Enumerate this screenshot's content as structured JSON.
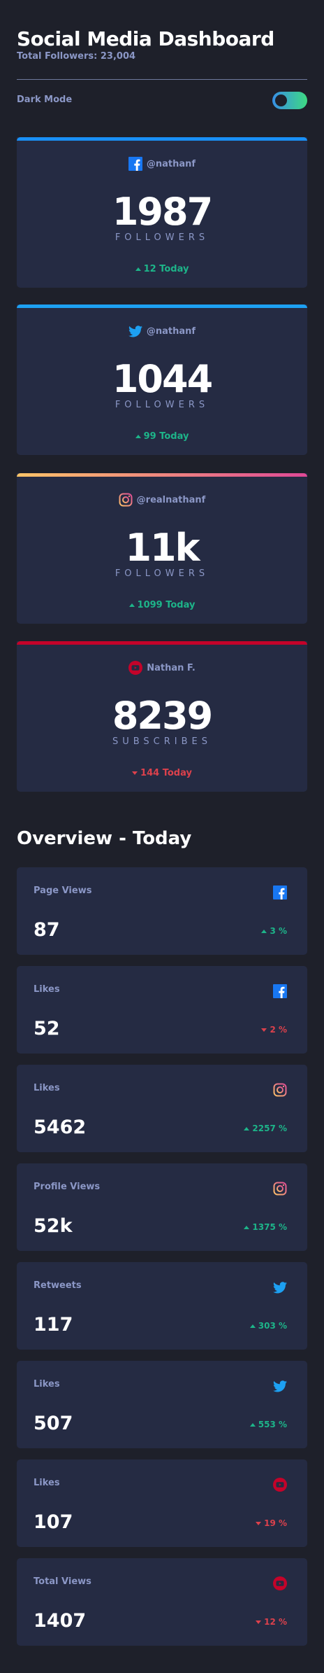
{
  "header": {
    "title": "Social Media Dashboard",
    "total_followers": "Total Followers: 23,004",
    "dark_mode_label": "Dark Mode",
    "dark_mode_on": true
  },
  "colors": {
    "facebook": "#1877f2",
    "twitter": "#1da0f2",
    "instagram_start": "#fdc468",
    "instagram_end": "#df4996",
    "youtube": "#c4032a",
    "up": "#1db489",
    "down": "#dc414c"
  },
  "cards": [
    {
      "platform": "facebook",
      "icon": "facebook-icon",
      "handle": "@nathanf",
      "count": "1987",
      "unit": "FOLLOWERS",
      "change": "12 Today",
      "direction": "up"
    },
    {
      "platform": "twitter",
      "icon": "twitter-icon",
      "handle": "@nathanf",
      "count": "1044",
      "unit": "FOLLOWERS",
      "change": "99 Today",
      "direction": "up"
    },
    {
      "platform": "instagram",
      "icon": "instagram-icon",
      "handle": "@realnathanf",
      "count": "11k",
      "unit": "FOLLOWERS",
      "change": "1099 Today",
      "direction": "up"
    },
    {
      "platform": "youtube",
      "icon": "youtube-icon",
      "handle": "Nathan F.",
      "count": "8239",
      "unit": "SUBSCRIBES",
      "change": "144 Today",
      "direction": "down"
    }
  ],
  "overview": {
    "title": "Overview - Today",
    "items": [
      {
        "metric": "Page Views",
        "platform": "facebook",
        "icon": "facebook-icon",
        "value": "87",
        "change": "3 %",
        "direction": "up"
      },
      {
        "metric": "Likes",
        "platform": "facebook",
        "icon": "facebook-icon",
        "value": "52",
        "change": "2 %",
        "direction": "down"
      },
      {
        "metric": "Likes",
        "platform": "instagram",
        "icon": "instagram-icon",
        "value": "5462",
        "change": "2257 %",
        "direction": "up"
      },
      {
        "metric": "Profile Views",
        "platform": "instagram",
        "icon": "instagram-icon",
        "value": "52k",
        "change": "1375 %",
        "direction": "up"
      },
      {
        "metric": "Retweets",
        "platform": "twitter",
        "icon": "twitter-icon",
        "value": "117",
        "change": "303 %",
        "direction": "up"
      },
      {
        "metric": "Likes",
        "platform": "twitter",
        "icon": "twitter-icon",
        "value": "507",
        "change": "553 %",
        "direction": "up"
      },
      {
        "metric": "Likes",
        "platform": "youtube",
        "icon": "youtube-icon",
        "value": "107",
        "change": "19 %",
        "direction": "down"
      },
      {
        "metric": "Total Views",
        "platform": "youtube",
        "icon": "youtube-icon",
        "value": "1407",
        "change": "12 %",
        "direction": "down"
      }
    ]
  }
}
